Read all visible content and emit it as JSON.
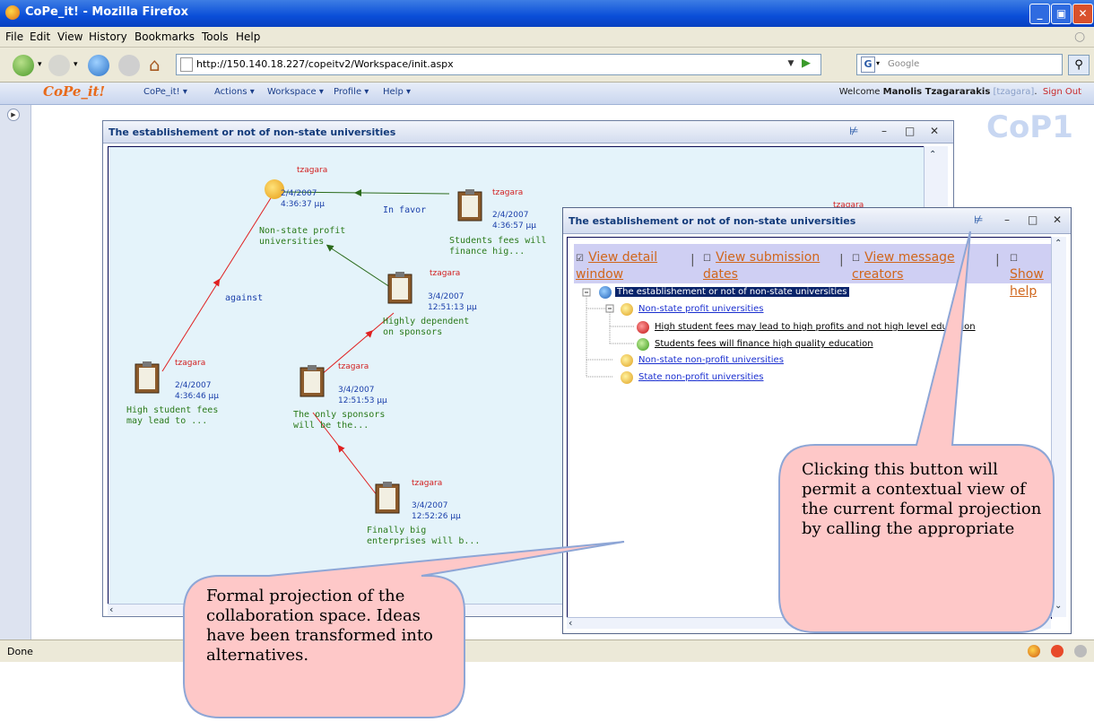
{
  "window": {
    "title": "CoPe_it! - Mozilla Firefox"
  },
  "menubar": [
    "File",
    "Edit",
    "View",
    "History",
    "Bookmarks",
    "Tools",
    "Help"
  ],
  "navbar": {
    "url": "http://150.140.18.227/copeitv2/Workspace/init.aspx",
    "search_placeholder": "Google"
  },
  "appbar": {
    "logo": "CoPe_it!",
    "menu": [
      "CoPe_it! ▾",
      "Actions ▾",
      "Workspace ▾",
      "Profile ▾",
      "Help ▾"
    ],
    "welcome_prefix": "Welcome ",
    "user_name": "Manolis Tzagararakis",
    "user_login": "[tzagara]",
    "welcome_suffix": ".",
    "signout": "Sign Out"
  },
  "workspace_label": "CoP1",
  "graph_window": {
    "title": "The establishement or not of non-state universities",
    "nodes": [
      {
        "user": "tzagara",
        "date": "2/4/2007",
        "time": "4:36:37 μμ",
        "label": "Non-state profit\nuniversities"
      },
      {
        "user": "tzagara",
        "date": "2/4/2007",
        "time": "4:36:57 μμ",
        "label": "Students fees will\nfinance hig..."
      },
      {
        "user": "tzagara",
        "date": "3/4/2007",
        "time": "12:51:13 μμ",
        "label": "Highly dependent\non sponsors"
      },
      {
        "user": "tzagara",
        "date": "2/4/2007",
        "time": "4:36:46 μμ",
        "label": "High student fees\nmay lead to ..."
      },
      {
        "user": "tzagara",
        "date": "3/4/2007",
        "time": "12:51:53 μμ",
        "label": "The only sponsors\nwill be the..."
      },
      {
        "user": "tzagara",
        "date": "3/4/2007",
        "time": "12:52:26 μμ",
        "label": "Finally big\nenterprises will b..."
      }
    ],
    "edge_labels": [
      "In favor",
      "against"
    ],
    "partial_user": "tzagara"
  },
  "tree_window": {
    "title": "The establishement or not of non-state universities",
    "toolbar": [
      {
        "mark": "☑",
        "label": "View detail window"
      },
      {
        "mark": "☐",
        "label": "View submission dates"
      },
      {
        "mark": "☐",
        "label": "View message creators"
      },
      {
        "mark": "☐",
        "label": "Show help"
      }
    ],
    "root": "The establishement or not of non-state universities",
    "items": [
      {
        "label": "Non-state profit universities",
        "level": 1
      },
      {
        "label": "High student fees may lead to high profits and not high level education",
        "level": 2,
        "kind": "against"
      },
      {
        "label": "Students fees will finance high quality education",
        "level": 2,
        "kind": "favor"
      },
      {
        "label": "Non-state non-profit universities",
        "level": 1
      },
      {
        "label": "State non-profit universities",
        "level": 1
      }
    ]
  },
  "callouts": {
    "left": "Formal projection of the collaboration space. Ideas have been transformed into alternatives.",
    "right": "Clicking this button will permit a contextual view of the current formal projection by calling the appropriate"
  },
  "statusbar": {
    "text": "Done"
  },
  "colors": {
    "titlebar": "#0a4ed8",
    "callout_fill": "#fec8c8",
    "callout_border": "#8ea6d6",
    "favor": "#2a7a1a",
    "against": "#e02020"
  }
}
